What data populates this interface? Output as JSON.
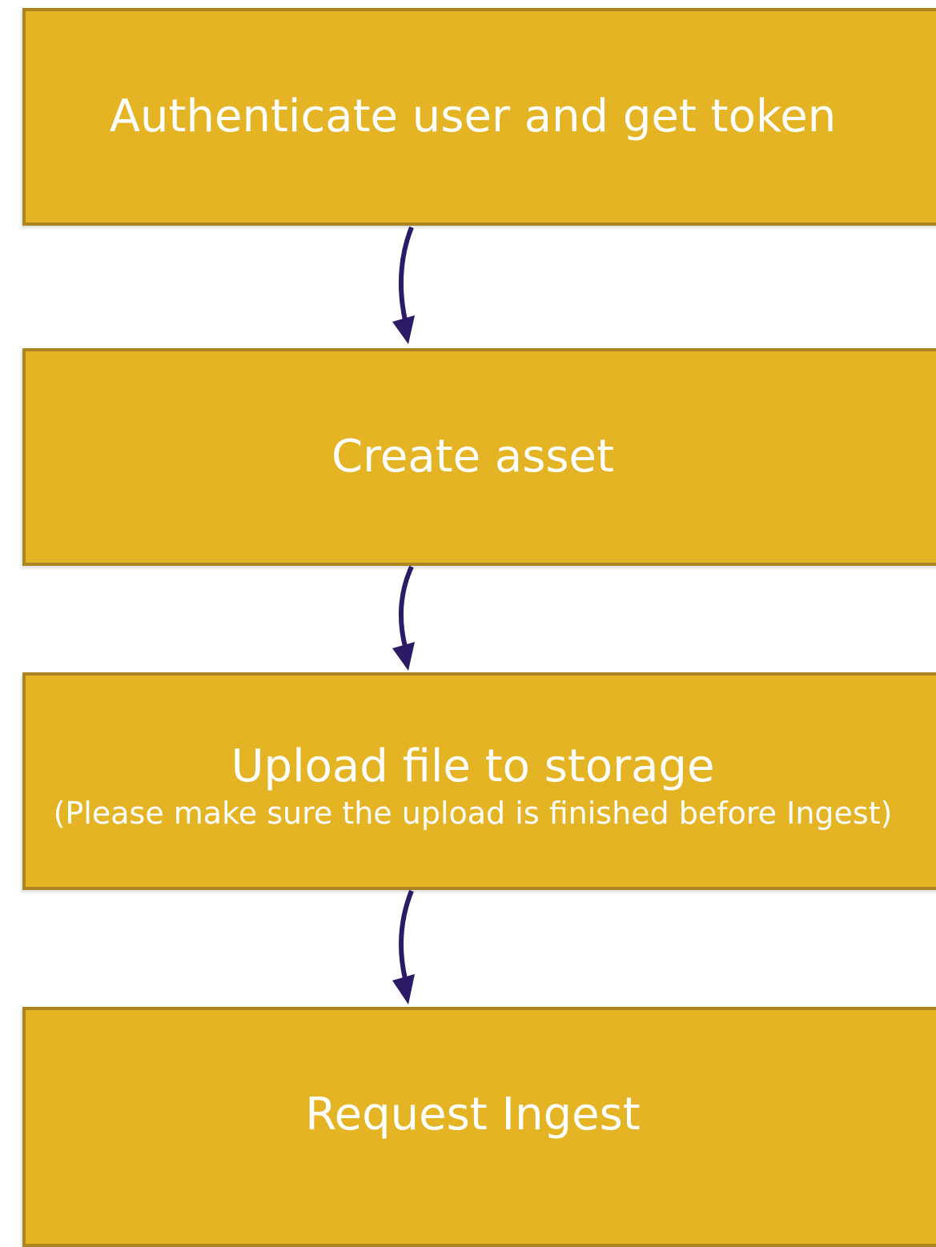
{
  "colors": {
    "box_fill": "#E5B424",
    "box_border": "#AD8520",
    "text": "#FFFFFF",
    "arrow": "#2B1A66"
  },
  "steps": [
    {
      "title": "Authenticate user and get token",
      "note": ""
    },
    {
      "title": "Create asset",
      "note": ""
    },
    {
      "title": "Upload file to storage",
      "note": "(Please make sure the upload is finished before Ingest)"
    },
    {
      "title": "Request Ingest",
      "note": ""
    }
  ]
}
